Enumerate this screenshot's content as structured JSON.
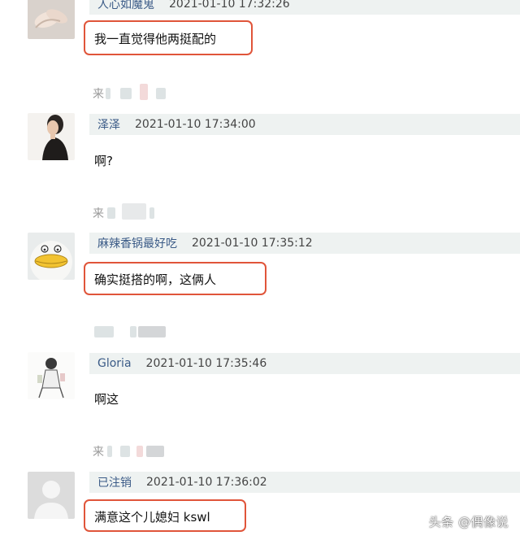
{
  "comments": [
    {
      "user": "人心如魔鬼",
      "time": "2021-01-10 17:32:26",
      "text": "我一直觉得他两挺配的",
      "avatar": "hands-avatar-icon",
      "highlighted": true
    },
    {
      "user": "泽泽",
      "time": "2021-01-10 17:34:00",
      "text": "啊?",
      "avatar": "woman-portrait-avatar-icon",
      "highlighted": false
    },
    {
      "user": "麻辣香锅最好吃",
      "time": "2021-01-10 17:35:12",
      "text": "确实挺搭的啊，这俩人",
      "avatar": "cartoon-duck-avatar-icon",
      "highlighted": true
    },
    {
      "user": "Gloria",
      "time": "2021-01-10 17:35:46",
      "text": "啊这",
      "avatar": "sketch-figure-avatar-icon",
      "highlighted": false
    },
    {
      "user": "已注销",
      "time": "2021-01-10 17:36:02",
      "text": "满意这个儿媳妇 kswl",
      "avatar": "default-user-avatar-icon",
      "highlighted": true
    }
  ],
  "reply_label": "来",
  "watermark": "头条 @偶像说",
  "colors": {
    "username": "#3b5b87",
    "header_bg": "#eef2f1",
    "highlight_border": "#e0553a"
  }
}
